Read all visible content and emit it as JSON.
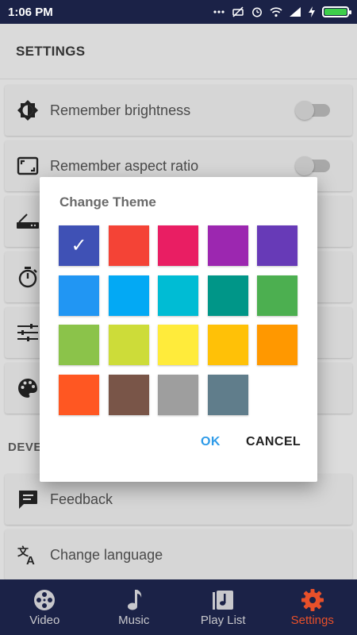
{
  "status_bar": {
    "time": "1:06 PM",
    "icons": [
      "signal-dots-icon",
      "mute-icon",
      "alarm-icon",
      "wifi-icon",
      "cell-signal-icon",
      "charging-icon",
      "battery-icon"
    ],
    "battery_color": "#3ecf4b"
  },
  "header": {
    "title": "SETTINGS"
  },
  "settings": {
    "items": [
      {
        "label": "Remember brightness",
        "icon": "brightness-icon",
        "toggle": false
      },
      {
        "label": "Remember aspect ratio",
        "icon": "aspect-ratio-icon",
        "toggle": false
      },
      {
        "label": "",
        "icon": "router-icon"
      },
      {
        "label": "",
        "icon": "timer-icon"
      },
      {
        "label": "",
        "icon": "equalizer-icon"
      },
      {
        "label": "",
        "icon": "palette-icon"
      }
    ],
    "section_label": "DEVE",
    "dev_items": [
      {
        "label": "Feedback",
        "icon": "feedback-icon"
      },
      {
        "label": "Change language",
        "icon": "translate-icon"
      }
    ]
  },
  "dialog": {
    "title": "Change Theme",
    "colors": [
      "#3f51b5",
      "#f44336",
      "#e91e63",
      "#9c27b0",
      "#673ab7",
      "#2196f3",
      "#03a9f4",
      "#00bcd4",
      "#009688",
      "#4caf50",
      "#8bc34a",
      "#cddc39",
      "#ffeb3b",
      "#ffc107",
      "#ff9800",
      "#ff5722",
      "#795548",
      "#9e9e9e",
      "#607d8b"
    ],
    "selected_index": 0,
    "check_mark": "✓",
    "ok_label": "OK",
    "cancel_label": "CANCEL"
  },
  "bottom_nav": {
    "items": [
      {
        "label": "Video",
        "icon": "film-reel-icon"
      },
      {
        "label": "Music",
        "icon": "music-note-icon"
      },
      {
        "label": "Play List",
        "icon": "playlist-icon"
      },
      {
        "label": "Settings",
        "icon": "gear-icon"
      }
    ],
    "active_index": 3,
    "active_color": "#e8502a"
  }
}
